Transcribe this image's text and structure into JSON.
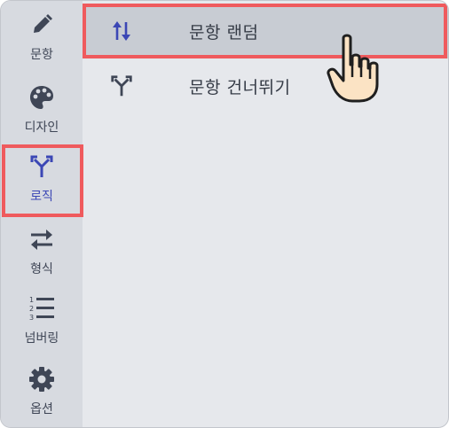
{
  "sidebar": {
    "items": [
      {
        "id": "question",
        "label": "문항",
        "icon": "pencil-icon"
      },
      {
        "id": "design",
        "label": "디자인",
        "icon": "palette-icon"
      },
      {
        "id": "logic",
        "label": "로직",
        "icon": "branch-icon",
        "active": true
      },
      {
        "id": "format",
        "label": "형식",
        "icon": "swap-arrows-icon"
      },
      {
        "id": "numbering",
        "label": "넘버링",
        "icon": "numbered-list-icon"
      },
      {
        "id": "options",
        "label": "옵션",
        "icon": "gear-icon"
      }
    ]
  },
  "menu": {
    "items": [
      {
        "label": "문항 랜덤",
        "icon": "shuffle-arrows-icon",
        "selected": true
      },
      {
        "label": "문항 건너뛰기",
        "icon": "branch-icon"
      }
    ]
  },
  "colors": {
    "highlight": "#ef5a5d",
    "active_accent": "#3b47b5",
    "sidebar_bg": "#d7dae0",
    "content_bg": "#e6e8ec",
    "selected_row_bg": "#c8ccd3"
  },
  "cursor": {
    "icon": "pointing-hand-cursor-icon"
  }
}
